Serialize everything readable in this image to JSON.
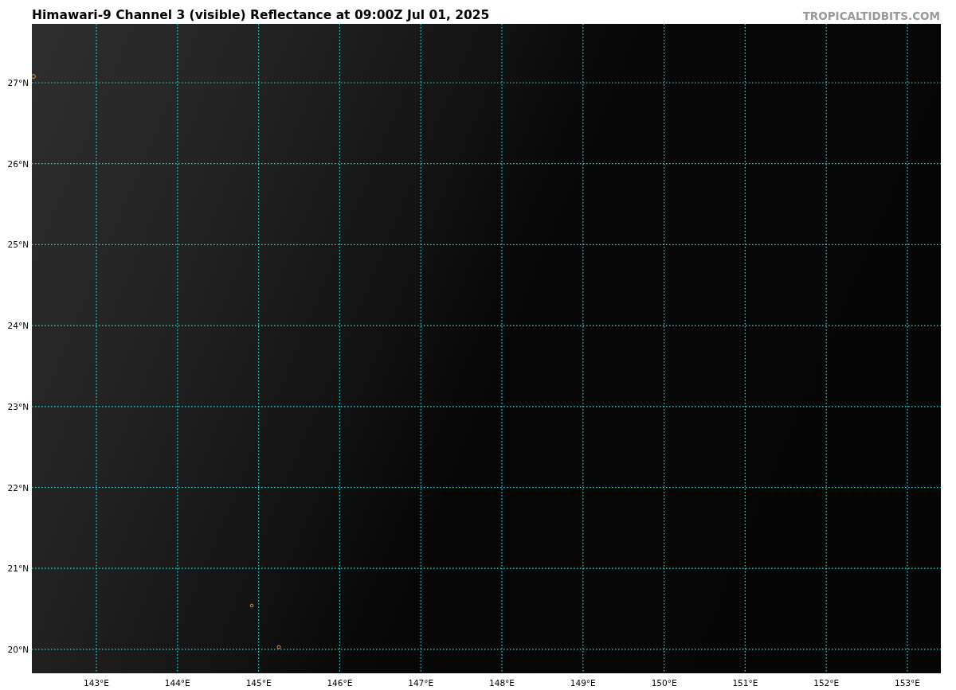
{
  "title": "Himawari-9 Channel 3 (visible) Reflectance at 09:00Z Jul 01, 2025",
  "site": "TROPICALTIDBITS.COM",
  "map": {
    "lat_labels": [
      "27°N",
      "26°N",
      "25°N",
      "24°N",
      "23°N",
      "22°N",
      "21°N",
      "20°N"
    ],
    "lon_labels": [
      "143°E",
      "144°E",
      "145°E",
      "146°E",
      "147°E",
      "148°E",
      "149°E",
      "150°E",
      "151°E",
      "152°E",
      "153°E"
    ]
  }
}
